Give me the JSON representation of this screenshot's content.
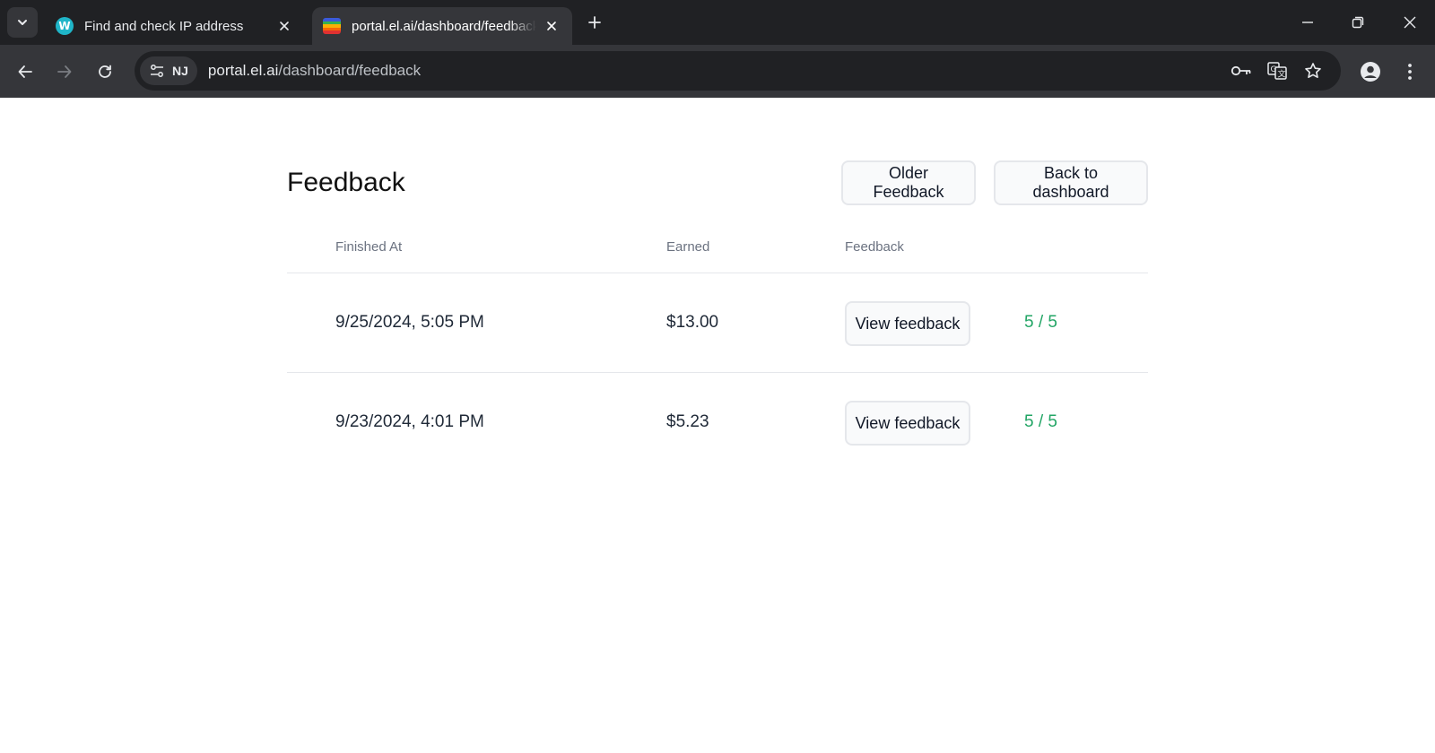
{
  "browser": {
    "tabs": [
      {
        "title": "Find and check IP address",
        "favicon": "w-logo-icon",
        "active": false
      },
      {
        "title": "portal.el.ai/dashboard/feedback",
        "favicon": "rainbow-logo-icon",
        "active": true
      }
    ],
    "site_chip": "NJ",
    "url_host": "portal.el.ai",
    "url_path": "/dashboard/feedback"
  },
  "page": {
    "title": "Feedback",
    "buttons": {
      "older": "Older Feedback",
      "back": "Back to dashboard"
    },
    "table": {
      "headers": {
        "finished_at": "Finished At",
        "earned": "Earned",
        "feedback": "Feedback"
      },
      "rows": [
        {
          "finished_at": "9/25/2024, 5:05 PM",
          "earned": "$13.00",
          "action": "View feedback",
          "score": "5 / 5"
        },
        {
          "finished_at": "9/23/2024, 4:01 PM",
          "earned": "$5.23",
          "action": "View feedback",
          "score": "5 / 5"
        }
      ]
    }
  },
  "colors": {
    "score_green": "#22a565",
    "chrome_dark": "#202124",
    "chrome_toolbar": "#35363a"
  }
}
